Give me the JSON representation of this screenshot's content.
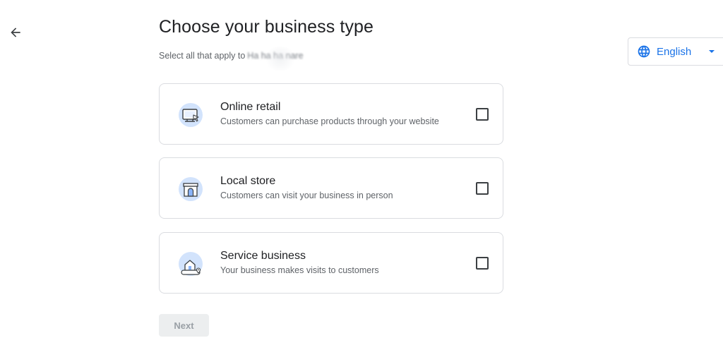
{
  "header": {
    "back_icon": "arrow-back-icon",
    "title": "Choose your business type",
    "subtitle_prefix": "Select all that apply to",
    "subtitle_business_name": "Ha ha ha nare"
  },
  "language": {
    "icon": "globe-icon",
    "label": "English",
    "caret_icon": "caret-down-icon",
    "accent": "#1a73e8"
  },
  "options": [
    {
      "icon": "computer-cursor-icon",
      "title": "Online retail",
      "description": "Customers can purchase products through your website",
      "checked": false
    },
    {
      "icon": "storefront-icon",
      "title": "Local store",
      "description": "Customers can visit your business in person",
      "checked": false
    },
    {
      "icon": "house-location-icon",
      "title": "Service business",
      "description": "Your business makes visits to customers",
      "checked": false
    }
  ],
  "footer": {
    "next_label": "Next",
    "next_disabled": true
  }
}
